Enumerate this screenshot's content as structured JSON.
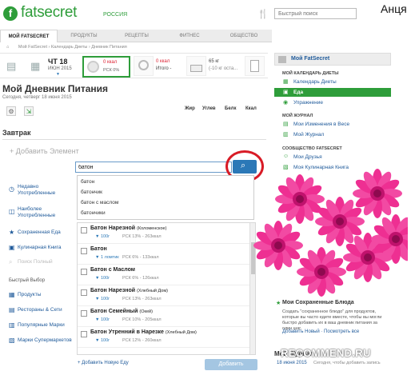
{
  "header": {
    "logo": "fatsecret",
    "region": "РОССИЯ",
    "search_placeholder": "Быстрый поиск",
    "user": "Анця",
    "tools_icon": "utensils-icon"
  },
  "nav": {
    "tabs": [
      "МОЙ FATSECRET",
      "ПРОДУКТЫ",
      "РЕЦЕПТЫ",
      "ФИТНЕС",
      "ОБЩЕСТВО"
    ]
  },
  "breadcrumb": [
    "Мой FatSecret",
    "Календарь Диеты",
    "Дневник Питания"
  ],
  "summary": {
    "date_day": "ЧТ 18",
    "date_month": "ИЮН 2015",
    "food_kcal": "0 ккал",
    "food_rsk": "РСК 0%",
    "exercise_kcal": "0 ккал",
    "exercise_label": "Итого -",
    "weight": "65 кг",
    "weight_sub": "(-10 кг оста..."
  },
  "diary": {
    "title": "Мой Дневник Питания",
    "date": "Сегодня, четверг 18 июня 2015",
    "columns": [
      "Жир",
      "Углев",
      "Белк",
      "Ккал"
    ],
    "meal": "Завтрак",
    "add_item": "+ Добавить Элемент",
    "search_value": "батон",
    "suggestions": [
      "батон",
      "батончик",
      "батон с маслом",
      "батончики"
    ],
    "side_links": [
      "Недавно Употребленные",
      "Наиболее Употребленные",
      "Сохраненная Еда",
      "Кулинарная Книга",
      "Поиск Полный"
    ],
    "quick_head": "Быстрый Выбор",
    "quick_links": [
      "Продукты",
      "Рестораны & Сети",
      "Популярные Марки",
      "Марки Супермаркетов"
    ],
    "results": [
      {
        "name": "Батон Нарезной",
        "brand": "(Коломенское)",
        "serving": "100г",
        "rsk": "РСК 13% - 263ккал"
      },
      {
        "name": "Батон",
        "brand": "",
        "serving": "1 ломтик",
        "rsk": "РСК 6% - 133ккал"
      },
      {
        "name": "Батон с Маслом",
        "brand": "",
        "serving": "100г",
        "rsk": "РСК 6% - 126ккал"
      },
      {
        "name": "Батон Нарезной",
        "brand": "(Хлебный Дом)",
        "serving": "100г",
        "rsk": "РСК 13% - 263ккал"
      },
      {
        "name": "Батон Семейный",
        "brand": "(Окей)",
        "serving": "100г",
        "rsk": "РСК 10% - 205ккал"
      },
      {
        "name": "Батон Утренний в Нарезке",
        "brand": "(Хлебный Дом)",
        "serving": "100г",
        "rsk": "РСК 12% - 260ккал"
      }
    ],
    "add_new": "+ Добавить Новую Еду",
    "add_button": "Добавить"
  },
  "sidebar": {
    "top": "Мой FatSecret",
    "calendar_head": "МОЙ КАЛЕНДАРЬ ДИЕТЫ",
    "calendar_items": [
      "Календарь Диеты",
      "Еда",
      "Упражнение"
    ],
    "journal_head": "МОЙ ЖУРНАЛ",
    "journal_items": [
      "Мои Изменения в Весе",
      "Мой Журнал"
    ],
    "community_head": "СООБЩЕСТВО FATSECRET",
    "community_items": [
      "Мои Друзья",
      "Моя Кулинарная Книга"
    ],
    "saved_title": "Мои Сохраненные Блюда",
    "saved_text": "Создать \"сохраненное блюдо\" для продуктов, которые вы часто едите вместе, чтобы вы могли быстро добавить их в ваш дневник питания за один шаг.",
    "saved_links": "Добавить Новый · Посмотреть все",
    "journal_title": "Мой Журнал",
    "journal_date": "18 июня 2015",
    "journal_text": "Сегодня, чтобы добавить запись"
  },
  "watermark": "RECOMMEND.RU"
}
